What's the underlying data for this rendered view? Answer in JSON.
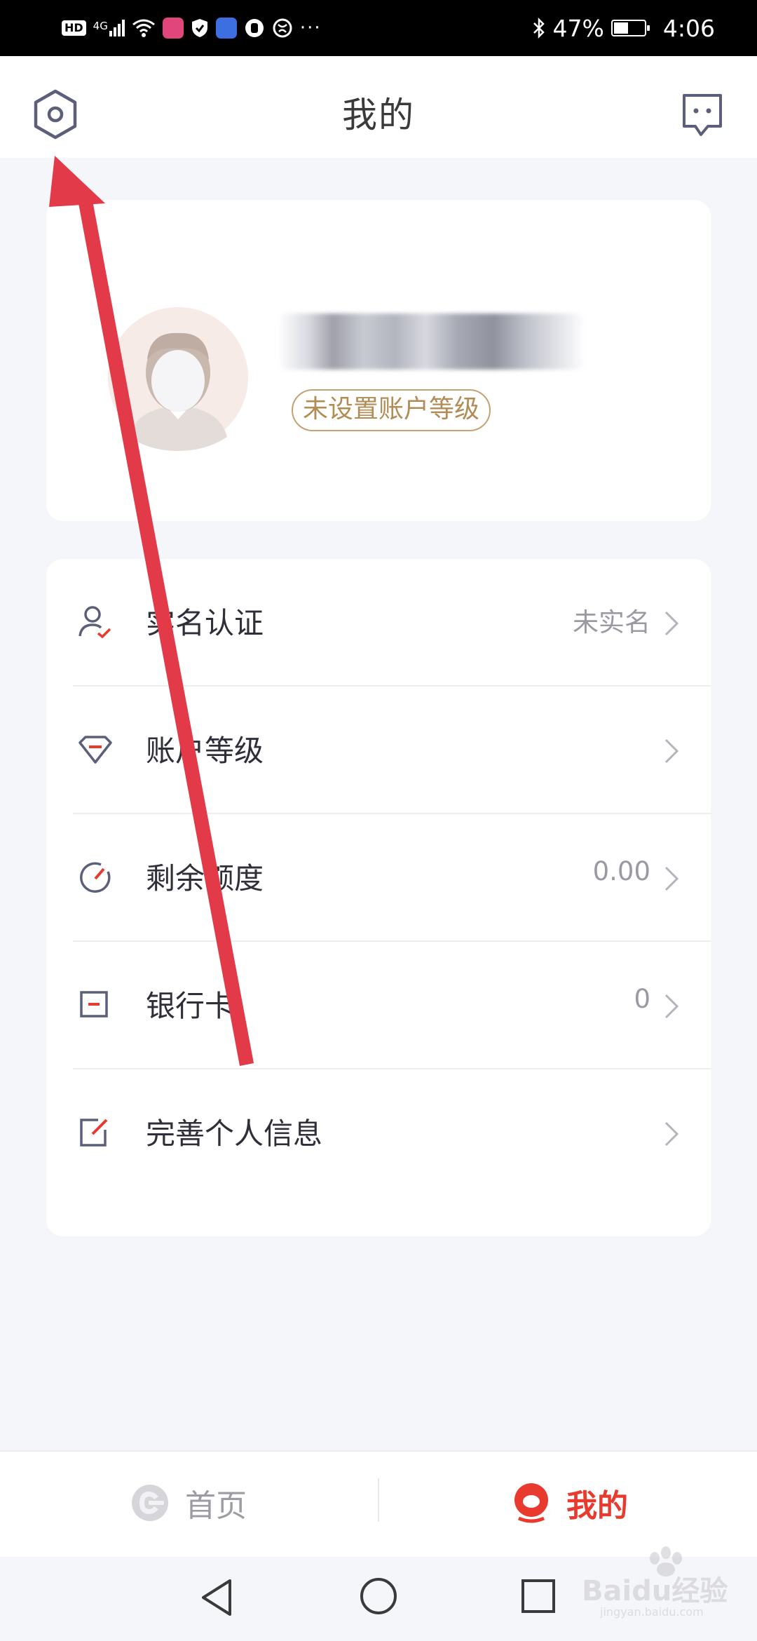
{
  "status_bar": {
    "hd": "HD",
    "network": "4G",
    "battery": "47%",
    "time": "4:06",
    "battery_level": 0.47,
    "ellipsis": "···"
  },
  "header": {
    "title": "我的",
    "left_icon": "settings-hexagon-icon",
    "right_icon": "message-icon"
  },
  "profile": {
    "avatar_icon": "user-avatar",
    "level_badge": "未设置账户等级"
  },
  "menu": {
    "items": [
      {
        "label": "实名认证",
        "value": "未实名",
        "icon": "id-verify-icon"
      },
      {
        "label": "账户等级",
        "value": "",
        "icon": "diamond-icon"
      },
      {
        "label": "剩余额度",
        "value": "0.00",
        "icon": "gauge-icon"
      },
      {
        "label": "银行卡",
        "value": "0",
        "icon": "bank-card-icon"
      },
      {
        "label": "完善个人信息",
        "value": "",
        "icon": "edit-icon"
      }
    ]
  },
  "tab_bar": {
    "home_label": "首页",
    "mine_label": "我的",
    "active": "mine"
  },
  "watermark": {
    "text": "Baidu经验",
    "sub": "jingyan.baidu.com"
  },
  "colors": {
    "accent": "#e83a2e",
    "gold": "#b38b55",
    "icon": "#5c5f7a",
    "annotation": "#e23a48"
  }
}
